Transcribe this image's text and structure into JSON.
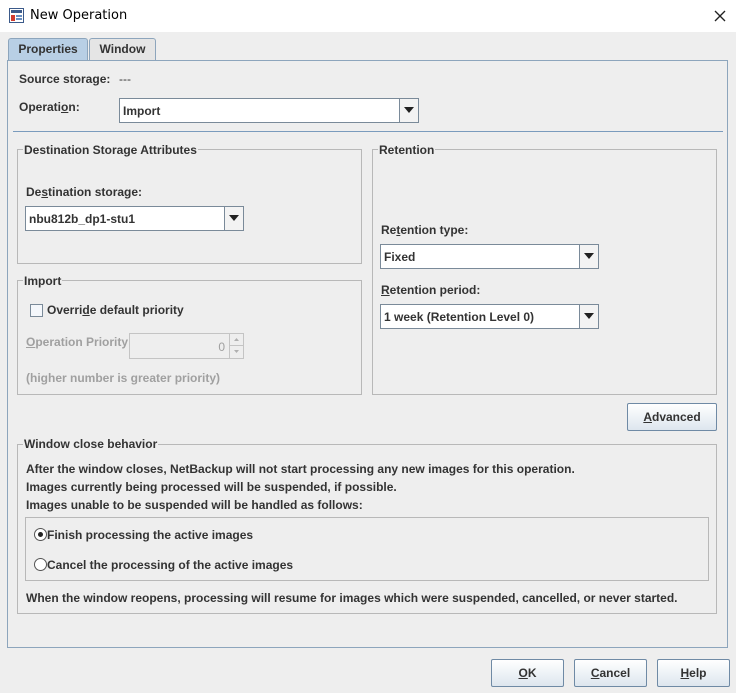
{
  "window": {
    "title": "New Operation"
  },
  "tabs": [
    {
      "label": "Properties",
      "selected": true
    },
    {
      "label": "Window",
      "selected": false
    }
  ],
  "properties": {
    "source_storage_label": "Source storage:",
    "source_storage_value": "---",
    "operation_label_pre": "Operati",
    "operation_label_key": "o",
    "operation_label_post": "n:",
    "operation_value": "Import"
  },
  "destination": {
    "group_title": "Destination Storage Attributes",
    "storage_label_pre": "De",
    "storage_label_key": "s",
    "storage_label_post": "tination storage:",
    "storage_value": "nbu812b_dp1-stu1"
  },
  "retention": {
    "group_title": "Retention",
    "type_label_pre": "Re",
    "type_label_key": "t",
    "type_label_post": "ention type:",
    "type_value": "Fixed",
    "period_label_pre": "",
    "period_label_key": "R",
    "period_label_post": "etention period:",
    "period_value": "1 week (Retention Level 0)"
  },
  "import": {
    "group_title": "Import",
    "override_label_pre": "Overri",
    "override_label_key": "d",
    "override_label_post": "e default priority",
    "override_checked": false,
    "priority_label_pre": "",
    "priority_label_key": "O",
    "priority_label_post": "peration Priority",
    "priority_value": "0",
    "priority_hint": "(higher number is greater priority)"
  },
  "advanced_button": {
    "pre": "",
    "key": "A",
    "post": "dvanced"
  },
  "window_close": {
    "group_title": "Window close behavior",
    "line1": "After the window closes, NetBackup will not start processing any new images for this operation.",
    "line2": "Images currently being processed will be suspended, if possible.",
    "line3": "Images unable to be suspended will be handled as follows:",
    "option_finish": "Finish processing the active images",
    "option_cancel": "Cancel the processing of the active images",
    "selected_option": "finish",
    "reopen_note": "When the window reopens, processing will resume for images which were suspended, cancelled, or never started."
  },
  "buttons": {
    "ok_key": "O",
    "ok_post": "K",
    "cancel_key": "C",
    "cancel_post": "ancel",
    "help_key": "H",
    "help_post": "elp"
  },
  "colors": {
    "selected_tab": "#b8cfe5",
    "panel_bg": "#eeeeee",
    "border": "#8da5bc"
  }
}
